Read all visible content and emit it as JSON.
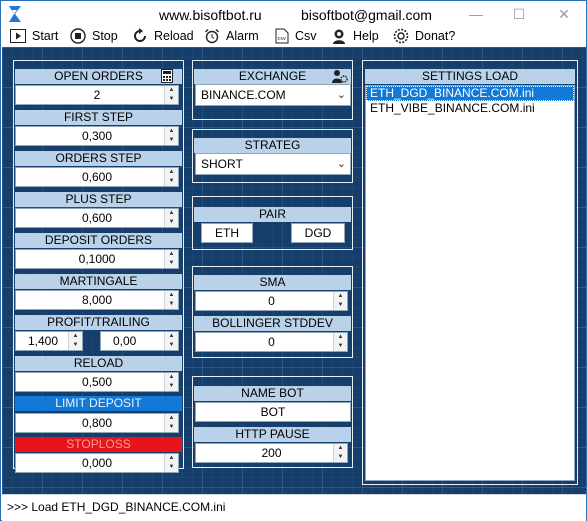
{
  "title": {
    "site": "www.bisoftbot.ru",
    "email": "bisoftbot@gmail.com"
  },
  "menu": {
    "start": "Start",
    "stop": "Stop",
    "reload": "Reload",
    "alarm": "Alarm",
    "csv": "Csv",
    "help": "Help",
    "donat": "Donat?"
  },
  "left": {
    "open_orders": {
      "label": "OPEN ORDERS",
      "value": "2"
    },
    "first_step": {
      "label": "FIRST STEP",
      "value": "0,300"
    },
    "orders_step": {
      "label": "ORDERS STEP",
      "value": "0,600"
    },
    "plus_step": {
      "label": "PLUS STEP",
      "value": "0,600"
    },
    "deposit_orders": {
      "label": "DEPOSIT ORDERS",
      "value": "0,1000"
    },
    "martingale": {
      "label": "MARTINGALE",
      "value": "8,000"
    },
    "profit_trailing": {
      "label": "PROFIT/TRAILING",
      "profit": "1,400",
      "trailing": "0,00"
    },
    "reload": {
      "label": "RELOAD",
      "value": "0,500"
    },
    "limit_deposit": {
      "label": "LIMIT DEPOSIT",
      "value": "0,800"
    },
    "stoploss": {
      "label": "STOPLOSS",
      "value": "0,000"
    }
  },
  "middle": {
    "exchange": {
      "label": "EXCHANGE",
      "value": "BINANCE.COM"
    },
    "strateg": {
      "label": "STRATEG",
      "value": "SHORT"
    },
    "pair": {
      "label": "PAIR",
      "base": "ETH",
      "quote": "DGD"
    },
    "sma": {
      "label": "SMA",
      "value": "0"
    },
    "bollinger": {
      "label": "BOLLINGER STDDEV",
      "value": "0"
    },
    "name_bot": {
      "label": "NAME BOT",
      "value": "BOT"
    },
    "http_pause": {
      "label": "HTTP PAUSE",
      "value": "200"
    }
  },
  "settings": {
    "label": "SETTINGS LOAD",
    "items": [
      "ETH_DGD_BINANCE.COM.ini",
      "ETH_VIBE_BINANCE.COM.ini"
    ]
  },
  "status": {
    "text": ">>> Load ETH_DGD_BINANCE.COM.ini"
  },
  "colors": {
    "background": "#163e6a",
    "label": "#b9d2ea",
    "limit": "#1379d6",
    "stoploss": "#e8141a"
  }
}
